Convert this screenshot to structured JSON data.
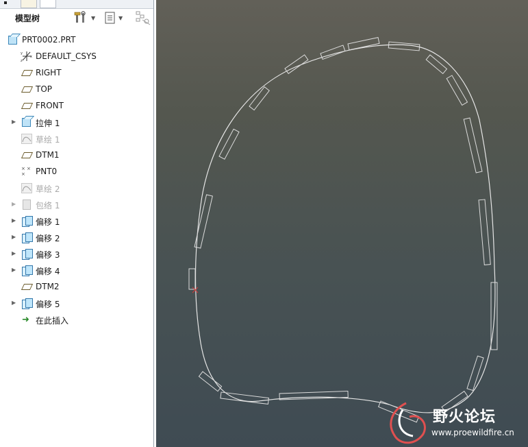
{
  "panel": {
    "title": "模型树"
  },
  "tree": {
    "items": [
      {
        "label": "PRT0002.PRT",
        "icon": "part-icon",
        "expandable": false,
        "dimmed": false
      },
      {
        "label": "DEFAULT_CSYS",
        "icon": "csys-icon",
        "expandable": false,
        "dimmed": false
      },
      {
        "label": "RIGHT",
        "icon": "datum-plane-icon",
        "expandable": false,
        "dimmed": false
      },
      {
        "label": "TOP",
        "icon": "datum-plane-icon",
        "expandable": false,
        "dimmed": false
      },
      {
        "label": "FRONT",
        "icon": "datum-plane-icon",
        "expandable": false,
        "dimmed": false
      },
      {
        "label": "拉伸 1",
        "icon": "extrude-icon",
        "expandable": true,
        "dimmed": false
      },
      {
        "label": "草绘 1",
        "icon": "sketch-icon",
        "expandable": false,
        "dimmed": true
      },
      {
        "label": "DTM1",
        "icon": "datum-plane-icon",
        "expandable": false,
        "dimmed": false
      },
      {
        "label": "PNT0",
        "icon": "datum-point-icon",
        "expandable": false,
        "dimmed": false
      },
      {
        "label": "草绘 2",
        "icon": "sketch-icon",
        "expandable": false,
        "dimmed": true
      },
      {
        "label": "包络 1",
        "icon": "wrap-icon",
        "expandable": true,
        "dimmed": true
      },
      {
        "label": "偏移 1",
        "icon": "offset-icon",
        "expandable": true,
        "dimmed": false
      },
      {
        "label": "偏移 2",
        "icon": "offset-icon",
        "expandable": true,
        "dimmed": false
      },
      {
        "label": "偏移 3",
        "icon": "offset-icon",
        "expandable": true,
        "dimmed": false
      },
      {
        "label": "偏移 4",
        "icon": "offset-icon",
        "expandable": true,
        "dimmed": false
      },
      {
        "label": "DTM2",
        "icon": "datum-plane-icon",
        "expandable": false,
        "dimmed": false
      },
      {
        "label": "偏移 5",
        "icon": "offset-icon",
        "expandable": true,
        "dimmed": false
      },
      {
        "label": "在此插入",
        "icon": "insert-here-arrow-icon",
        "expandable": false,
        "dimmed": false
      }
    ]
  },
  "watermark": {
    "title": "野火论坛",
    "url": "www.proewildfire.cn"
  },
  "colors": {
    "viewport_top": "#626058",
    "viewport_bottom": "#3f4b53",
    "curve": "#e6e6e6",
    "point_marker": "#d43a3a"
  }
}
